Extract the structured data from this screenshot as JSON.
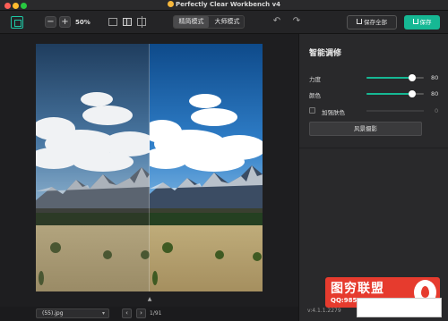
{
  "window": {
    "title": "Perfectly Clear Workbench v4"
  },
  "toolbar": {
    "zoom_out_label": "−",
    "zoom_in_label": "+",
    "zoom_level": "50%",
    "mode_simple": "精简模式",
    "mode_master": "大师模式",
    "undo_label": "↶",
    "redo_label": "↷",
    "save_all_label": "保存全部",
    "save_label": "保存",
    "accent_color": "#16b894"
  },
  "panel": {
    "title": "智能调修",
    "sliders": [
      {
        "label": "力度",
        "value": "80",
        "fraction": 0.8
      },
      {
        "label": "颜色",
        "value": "80",
        "fraction": 0.8
      }
    ],
    "checkbox": {
      "label": "加强肤色",
      "value": "0",
      "checked": false
    },
    "preset_button": "风景摄影",
    "version": "v:4.1.1.2279"
  },
  "bottom": {
    "file_name": "(55).jpg",
    "prev_label": "‹",
    "next_label": "›",
    "page_count": "1/91"
  },
  "icons": {
    "crop": "crop-icon",
    "view_single": "single-view-icon",
    "view_split": "split-view-icon",
    "view_compare": "compare-view-icon",
    "collapse": "chevron-up-icon"
  },
  "watermark": {
    "brand": "图穷联盟",
    "qq": "QQ:985303259"
  }
}
